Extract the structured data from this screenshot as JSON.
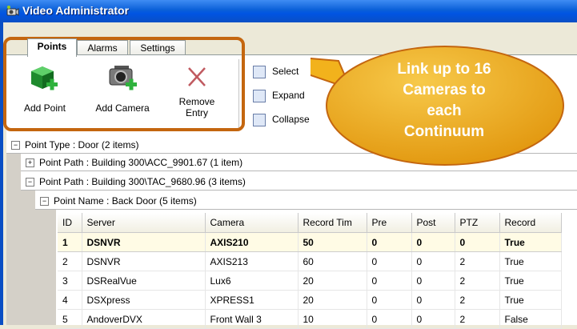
{
  "window": {
    "title": "Video Administrator"
  },
  "tabs": [
    {
      "label": "Points"
    },
    {
      "label": "Alarms"
    },
    {
      "label": "Settings"
    }
  ],
  "ribbon": {
    "add_point": "Add Point",
    "add_camera": "Add Camera",
    "remove_entry_line1": "Remove",
    "remove_entry_line2": "Entry",
    "select": "Select",
    "expand": "Expand",
    "collapse": "Collapse"
  },
  "callout": {
    "lines": [
      "Link up to 16",
      "Cameras to",
      "each",
      "Continuum"
    ]
  },
  "groups": {
    "point_type": "Point Type : Door (2 items)",
    "path1": "Point Path : Building 300\\ACC_9901.67 (1 item)",
    "path2": "Point Path : Building 300\\TAC_9680.96 (3 items)",
    "point_name": "Point Name : Back Door (5 items)"
  },
  "table": {
    "headers": [
      "ID",
      "Server",
      "Camera",
      "Record Tim",
      "Pre",
      "Post",
      "PTZ",
      "Record"
    ],
    "rows": [
      [
        "1",
        "DSNVR",
        "AXIS210",
        "50",
        "0",
        "0",
        "0",
        "True"
      ],
      [
        "2",
        "DSNVR",
        "AXIS213",
        "60",
        "0",
        "0",
        "2",
        "True"
      ],
      [
        "3",
        "DSRealVue",
        "Lux6",
        "20",
        "0",
        "0",
        "2",
        "True"
      ],
      [
        "4",
        "DSXpress",
        "XPRESS1",
        "20",
        "0",
        "0",
        "2",
        "True"
      ],
      [
        "5",
        "AndoverDVX",
        "Front Wall 3",
        "10",
        "0",
        "0",
        "2",
        "False"
      ]
    ]
  },
  "colors": {
    "callout_fill": "#f2b21c",
    "callout_border": "#c4660f",
    "titlebar": "#0054e3"
  }
}
